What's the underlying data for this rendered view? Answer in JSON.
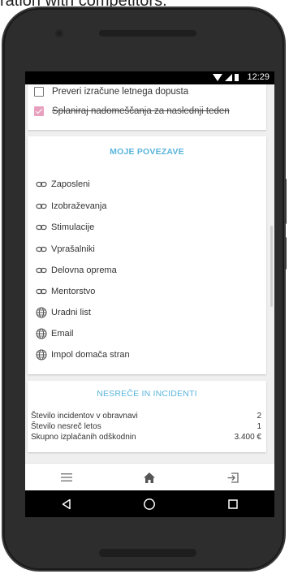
{
  "caption": "ration with competitors.",
  "status_bar": {
    "time": "12:29"
  },
  "tasks": [
    {
      "label": "Preveri izračune letnega dopusta",
      "checked": false
    },
    {
      "label": "Splaniraj nadomeščanja za naslednji teden",
      "checked": true
    }
  ],
  "links": {
    "title": "MOJE POVEZAVE",
    "items": [
      {
        "label": "Zaposleni",
        "icon": "link-icon"
      },
      {
        "label": "Izobraževanja",
        "icon": "link-icon"
      },
      {
        "label": "Stimulacije",
        "icon": "link-icon"
      },
      {
        "label": "Vprašalniki",
        "icon": "link-icon"
      },
      {
        "label": "Delovna oprema",
        "icon": "link-icon"
      },
      {
        "label": "Mentorstvo",
        "icon": "link-icon"
      },
      {
        "label": "Uradni list",
        "icon": "globe-icon"
      },
      {
        "label": "Email",
        "icon": "globe-icon"
      },
      {
        "label": "Impol domača stran",
        "icon": "globe-icon"
      }
    ]
  },
  "incidents": {
    "title": "NESREČE IN INCIDENTI",
    "rows": [
      {
        "label": "Število incidentov v obravnavi",
        "value": "2"
      },
      {
        "label": "Število nesreč letos",
        "value": "1"
      },
      {
        "label": "Skupno izplačanih odškodnin",
        "value": "3.400 €"
      }
    ]
  },
  "bottom_nav": [
    "menu-icon",
    "home-icon",
    "logout-icon"
  ],
  "system_nav": [
    "back-icon",
    "home-circle-icon",
    "recents-icon"
  ],
  "colors": {
    "accent": "#5ab4dc",
    "checkbox_checked": "#e8a0be"
  }
}
